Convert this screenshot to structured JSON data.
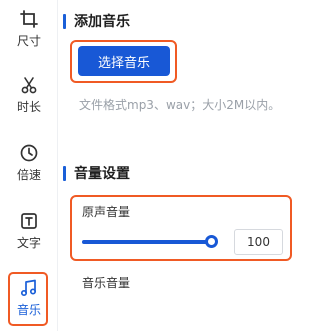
{
  "colors": {
    "accent": "#1858d6",
    "highlight": "#f05a24"
  },
  "sidebar": {
    "items": [
      {
        "label": "尺寸",
        "icon": "crop-icon"
      },
      {
        "label": "时长",
        "icon": "scissors-icon"
      },
      {
        "label": "倍速",
        "icon": "clock-icon"
      },
      {
        "label": "文字",
        "icon": "text-icon"
      },
      {
        "label": "音乐",
        "icon": "music-note-icon",
        "active": true
      }
    ]
  },
  "add_music": {
    "title": "添加音乐",
    "button_label": "选择音乐",
    "hint": "文件格式mp3、wav；大小2M以内。"
  },
  "volume_settings": {
    "title": "音量设置",
    "original_label": "原声音量",
    "original_value": "100",
    "original_level": 1.0,
    "music_label": "音乐音量"
  }
}
